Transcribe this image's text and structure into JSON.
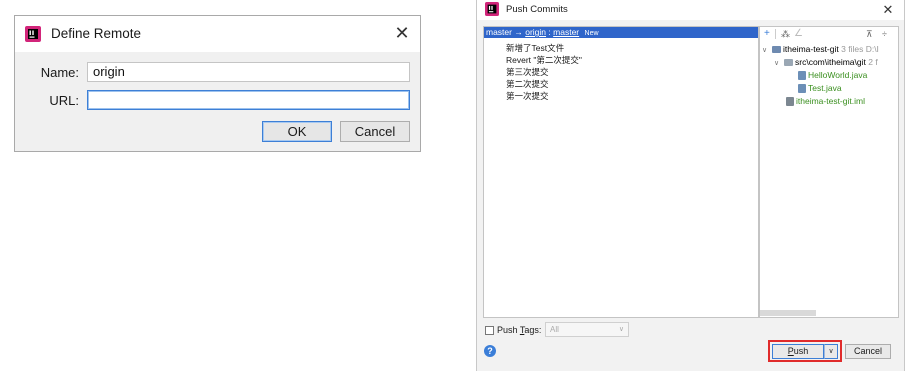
{
  "define_remote": {
    "title": "Define Remote",
    "close_glyph": "✕",
    "name_label": "Name:",
    "name_value": "origin",
    "url_label": "URL:",
    "url_value": "",
    "ok_label": "OK",
    "cancel_label": "Cancel",
    "icon": "intellij-app-icon"
  },
  "push_commits": {
    "title": "Push Commits",
    "close_glyph": "✕",
    "icon": "intellij-app-icon",
    "branch": {
      "local": "master",
      "arrow": "→",
      "remote": "origin",
      "separator": ":",
      "remote_branch": "master",
      "badge": "New"
    },
    "commits": [
      "新增了Test文件",
      "Revert \"第二次提交\"",
      "第三次提交",
      "第二次提交",
      "第一次提交"
    ],
    "tree": {
      "toolbar_icons": [
        "add-icon",
        "group-by-icon",
        "edit-icon",
        "expand-all-icon",
        "collapse-all-icon"
      ],
      "root_name": "itheima-test-git",
      "root_meta": "3 files D:\\I",
      "folder_name": "src\\com\\itheima\\git",
      "folder_meta": "2 f",
      "files": [
        "HelloWorld.java",
        "Test.java"
      ],
      "iml_file": "itheima-test-git.iml"
    },
    "push_tags_label_prefix": "Push ",
    "push_tags_label_underlined": "T",
    "push_tags_label_suffix": "ags:",
    "tags_select_value": "All",
    "help_glyph": "?",
    "push_label_underlined": "P",
    "push_label_rest": "ush",
    "cancel_label": "Cancel",
    "colors": {
      "selection": "#2f65ca",
      "added_file": "#3a8f1f",
      "highlight_box": "#e02b2b",
      "focus": "#3d7fd6"
    }
  }
}
